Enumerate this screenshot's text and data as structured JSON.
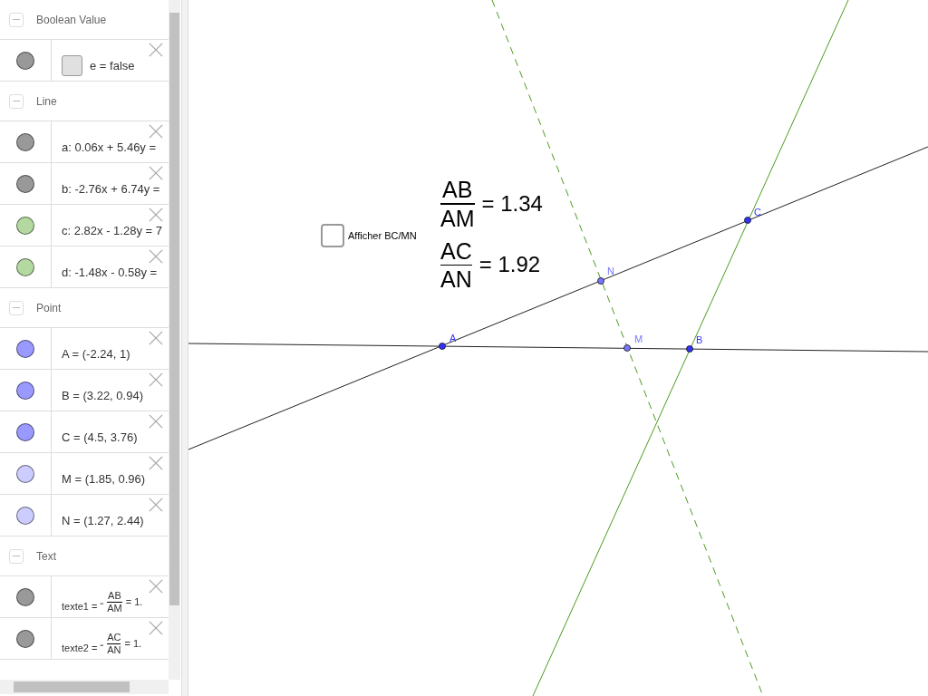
{
  "algebra": {
    "sections": [
      {
        "title": "Boolean Value",
        "expanded": true,
        "items": [
          {
            "kind": "checkbox",
            "label": "e = false",
            "checked": false,
            "color": "#999999"
          }
        ]
      },
      {
        "title": "Line",
        "expanded": true,
        "items": [
          {
            "kind": "plain",
            "label": "a: 0.06x + 5.46y =",
            "color": "#999999"
          },
          {
            "kind": "plain",
            "label": "b: -2.76x + 6.74y =",
            "color": "#999999"
          },
          {
            "kind": "plain",
            "label": "c: 2.82x - 1.28y = 7",
            "color": "#b3d9a0"
          },
          {
            "kind": "plain",
            "label": "d: -1.48x - 0.58y =",
            "color": "#b3d9a0"
          }
        ]
      },
      {
        "title": "Point",
        "expanded": true,
        "items": [
          {
            "kind": "plain",
            "label": "A = (-2.24, 1)",
            "color": "#9999ff"
          },
          {
            "kind": "plain",
            "label": "B = (3.22, 0.94)",
            "color": "#9999ff"
          },
          {
            "kind": "plain",
            "label": "C = (4.5, 3.76)",
            "color": "#9999ff"
          },
          {
            "kind": "plain",
            "label": "M = (1.85, 0.96)",
            "color": "#ccccff"
          },
          {
            "kind": "plain",
            "label": "N = (1.27, 2.44)",
            "color": "#ccccff"
          }
        ]
      },
      {
        "title": "Text",
        "expanded": true,
        "items": [
          {
            "kind": "fraction",
            "prefix": "texte1 = “",
            "numerator": "AB",
            "denominator": "AM",
            "suffix": "= 1.",
            "color": "#999999"
          },
          {
            "kind": "fraction",
            "prefix": "texte2 = “",
            "numerator": "AC",
            "denominator": "AN",
            "suffix": "= 1.",
            "color": "#999999"
          }
        ]
      }
    ]
  },
  "canvas": {
    "checkbox": {
      "label": "Afficher BC/MN",
      "checked": false
    },
    "ratios": [
      {
        "numerator": "AB",
        "denominator": "AM",
        "value": "= 1.34"
      },
      {
        "numerator": "AC",
        "denominator": "AN",
        "value": "= 1.92"
      }
    ],
    "points": [
      {
        "label": "A",
        "color": "#3333ff"
      },
      {
        "label": "B",
        "color": "#3333ff"
      },
      {
        "label": "C",
        "color": "#3333ff"
      },
      {
        "label": "M",
        "color": "#7777ff"
      },
      {
        "label": "N",
        "color": "#7777ff"
      }
    ]
  }
}
